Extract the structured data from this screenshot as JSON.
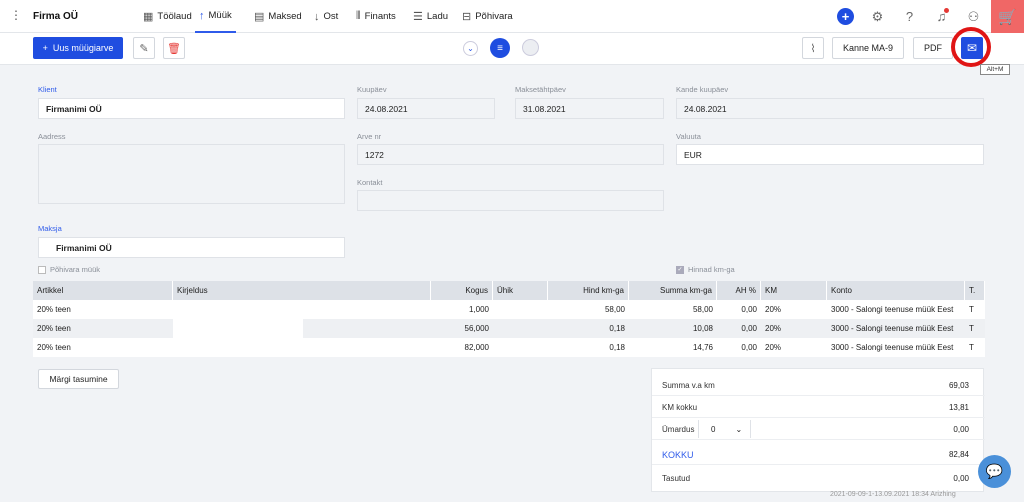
{
  "app": {
    "company": "Firma OÜ"
  },
  "nav": [
    {
      "label": "Töölaud",
      "icon": "grid-icon"
    },
    {
      "label": "Müük",
      "icon": "arrow-up-icon"
    },
    {
      "label": "Maksed",
      "icon": "payments-icon"
    },
    {
      "label": "Ost",
      "icon": "arrow-down-icon"
    },
    {
      "label": "Finants",
      "icon": "chart-icon"
    },
    {
      "label": "Ladu",
      "icon": "stack-icon"
    },
    {
      "label": "Põhivara",
      "icon": "briefcase-icon"
    }
  ],
  "toolbar": {
    "new_sale_label": "Uus müügiarve",
    "entry_label": "Kanne MA-9",
    "pdf_label": "PDF",
    "shortcut_tooltip": "Alt+M"
  },
  "form": {
    "client_label": "Klient",
    "client_value": "Firmanimi OÜ",
    "date_label": "Kuupäev",
    "date_value": "24.08.2021",
    "due_label": "Maksetähtpäev",
    "due_value": "31.08.2021",
    "entry_date_label": "Kande kuupäev",
    "entry_date_value": "24.08.2021",
    "address_label": "Aadress",
    "invoice_no_label": "Arve nr",
    "invoice_no_value": "1272",
    "currency_label": "Valuuta",
    "currency_value": "EUR",
    "contact_label": "Kontakt",
    "payer_label": "Maksja",
    "payer_value": "Firmanimi OÜ",
    "fixed_asset_label": "Põhivara müük",
    "prices_vat_label": "Hinnad km-ga"
  },
  "table": {
    "headers": [
      "Artikkel",
      "Kirjeldus",
      "Kogus",
      "Ühik",
      "Hind km-ga",
      "Summa km-ga",
      "AH %",
      "KM",
      "Konto",
      "T."
    ],
    "rows": [
      [
        "20% teen",
        "",
        "1,000",
        "",
        "58,00",
        "58,00",
        "0,00",
        "20%",
        "3000 - Salongi teenuse müük Eest",
        "T"
      ],
      [
        "20% teen",
        "",
        "56,000",
        "",
        "0,18",
        "10,08",
        "0,00",
        "20%",
        "3000 - Salongi teenuse müük Eest",
        "T"
      ],
      [
        "20% teen",
        "",
        "82,000",
        "",
        "0,18",
        "14,76",
        "0,00",
        "20%",
        "3000 - Salongi teenuse müük Eest",
        "T"
      ]
    ]
  },
  "actions": {
    "mark_payment_label": "Märgi tasumine"
  },
  "summary": {
    "net_label": "Summa v.a km",
    "net_value": "69,03",
    "vat_label": "KM kokku",
    "vat_value": "13,81",
    "rounding_label": "Ümardus",
    "rounding_select": "0",
    "rounding_value": "0,00",
    "total_label": "KOKKU",
    "total_value": "82,84",
    "paid_label": "Tasutud",
    "paid_value": "0,00"
  },
  "footer": {
    "note": "2021-09-09-1-13.09.2021 18:34 Arizhing"
  }
}
